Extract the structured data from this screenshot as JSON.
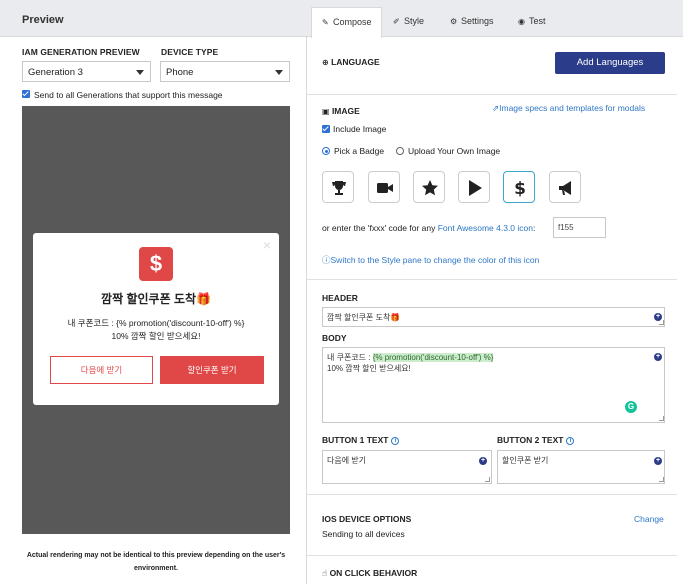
{
  "left": {
    "title": "Preview",
    "iam_label": "IAM GENERATION PREVIEW",
    "iam_value": "Generation 3",
    "device_label": "DEVICE TYPE",
    "device_value": "Phone",
    "send_all": "Send to all Generations that support this message",
    "disclaimer": "Actual rendering may not be identical to this preview depending on the user's environment."
  },
  "modal": {
    "close": "×",
    "icon_glyph": "$",
    "header": "깜짝 할인쿠폰 도착🎁",
    "body": "내 쿠폰코드 : {% promotion('discount-10-off') %}\n10% 깜짝 할인 받으세요!",
    "button1": "다음에 받기",
    "button2": "할인쿠폰 받기",
    "colors": {
      "accent": "#e04848",
      "overlay": "#585858"
    }
  },
  "tabs": [
    {
      "label": "Compose",
      "icon": "pencil-icon",
      "active": true
    },
    {
      "label": "Style",
      "icon": "brush-icon",
      "active": false
    },
    {
      "label": "Settings",
      "icon": "gear-icon",
      "active": false
    },
    {
      "label": "Test",
      "icon": "eye-icon",
      "active": false
    }
  ],
  "language": {
    "heading": "LANGUAGE",
    "add_button": "Add Languages"
  },
  "image": {
    "heading": "IMAGE",
    "specs_link": "Image specs and templates for modals",
    "include_image": "Include Image",
    "pick_badge": "Pick a Badge",
    "upload_own": "Upload Your Own Image",
    "badges": [
      "trophy-icon",
      "video-camera-icon",
      "star-icon",
      "play-icon",
      "dollar-icon",
      "bullhorn-icon"
    ],
    "selected_badge": "dollar-icon",
    "code_prefix": "or enter the 'fxxx' code for any ",
    "code_link": "Font Awesome 4.3.0 icon",
    "code_suffix": ":",
    "code_value": "f155",
    "style_link": "Switch to the Style pane to change the color of this icon"
  },
  "header": {
    "label": "HEADER",
    "value": "깜짝 할인쿠폰 도착🎁"
  },
  "body": {
    "label": "BODY",
    "line1_prefix": "내 쿠폰코드 : ",
    "line1_tag": "{% promotion('discount-10-off') %}",
    "line2": "10% 깜짝 할인 받으세요!"
  },
  "button1": {
    "label": "BUTTON 1 TEXT",
    "value": "다음에 받기"
  },
  "button2": {
    "label": "BUTTON 2 TEXT",
    "value": "할인쿠폰 받기"
  },
  "ios": {
    "heading": "IOS DEVICE OPTIONS",
    "change": "Change",
    "status": "Sending to all devices"
  },
  "onclick": {
    "heading": "ON CLICK BEHAVIOR"
  }
}
